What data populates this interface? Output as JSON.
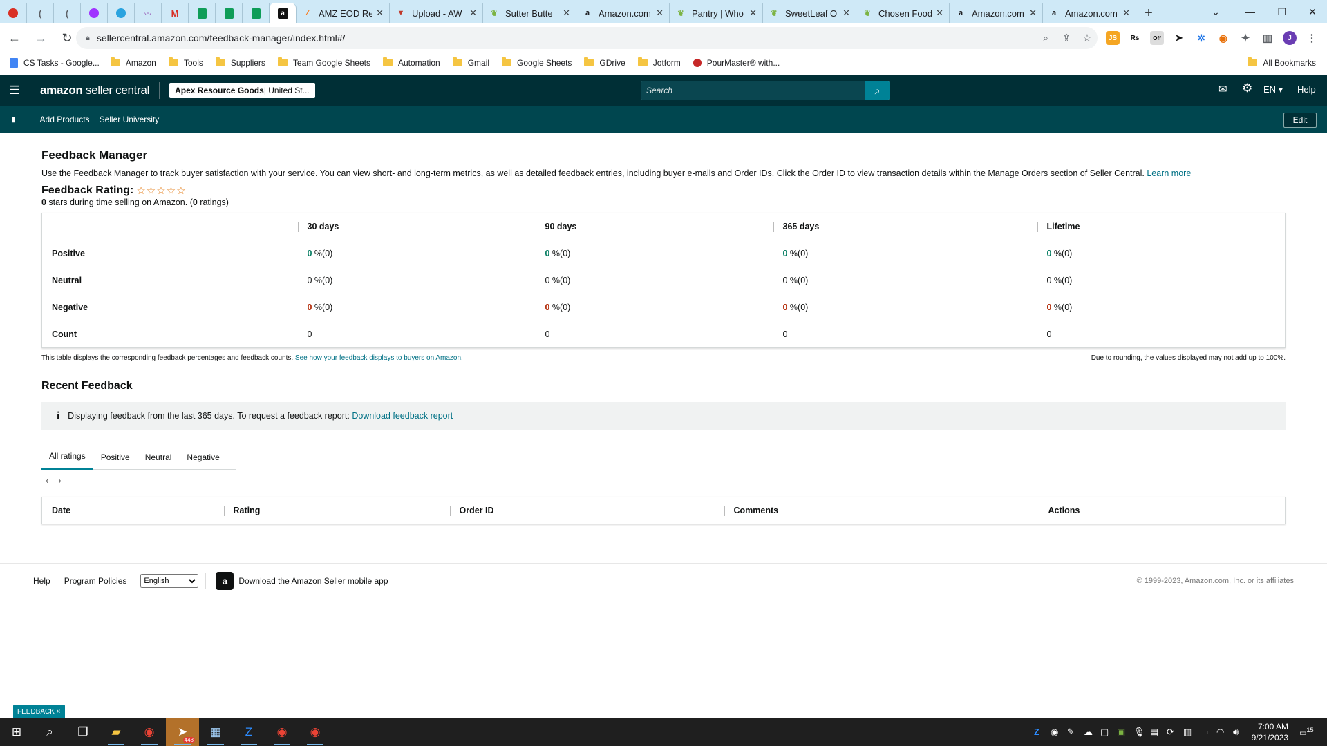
{
  "browser": {
    "tabs": [
      {
        "label": "AMZ EOD Re"
      },
      {
        "label": "Upload - AW"
      },
      {
        "label": "Sutter Butte"
      },
      {
        "label": "Amazon.com"
      },
      {
        "label": "Pantry | Who"
      },
      {
        "label": "SweetLeaf Or"
      },
      {
        "label": "Chosen Food"
      },
      {
        "label": "Amazon.com"
      },
      {
        "label": "Amazon.com"
      }
    ],
    "url": "sellercentral.amazon.com/feedback-manager/index.html#/",
    "ext_off_badge": "Off",
    "profile_initial": "J",
    "bookmarks": [
      "CS Tasks - Google...",
      "Amazon",
      "Tools",
      "Suppliers",
      "Team Google Sheets",
      "Automation",
      "Gmail",
      "Google Sheets",
      "GDrive",
      "Jotform",
      "PourMaster® with..."
    ],
    "all_bookmarks": "All Bookmarks"
  },
  "header": {
    "logo_bold": "amazon",
    "logo_rest": " seller central",
    "store_bold": "Apex Resource Goods",
    "store_rest": " | United St...",
    "search_placeholder": "Search",
    "lang": "EN ▾",
    "help": "Help"
  },
  "subnav": {
    "add_products": "Add Products",
    "seller_university": "Seller University",
    "edit": "Edit"
  },
  "page": {
    "title": "Feedback Manager",
    "desc": "Use the Feedback Manager to track buyer satisfaction with your service. You can view short- and long-term metrics, as well as detailed feedback entries, including buyer e-mails and Order IDs. Click the Order ID to view transaction details within the Manage Orders section of Seller Central.",
    "learn_more": "Learn more",
    "rating_label": "Feedback Rating:",
    "stars": "☆☆☆☆☆",
    "stars_value": "0",
    "stars_text": " stars during time selling on Amazon. (",
    "ratings_count": "0",
    "ratings_text": " ratings)"
  },
  "metrics": {
    "columns": [
      "30 days",
      "90 days",
      "365 days",
      "Lifetime"
    ],
    "rows": [
      {
        "label": "Positive",
        "cells": [
          "0",
          "0",
          "0",
          "0"
        ],
        "suffix": " %(0)"
      },
      {
        "label": "Neutral",
        "cells": [
          "0",
          "0",
          "0",
          "0"
        ],
        "suffix": " %(0)"
      },
      {
        "label": "Negative",
        "cells": [
          "0",
          "0",
          "0",
          "0"
        ],
        "suffix": " %(0)"
      },
      {
        "label": "Count",
        "cells": [
          "0",
          "0",
          "0",
          "0"
        ]
      }
    ],
    "note_left": "This table displays the corresponding feedback percentages and feedback counts.",
    "note_link": "See how your feedback displays to buyers on Amazon.",
    "note_right": "Due to rounding, the values displayed may not add up to 100%."
  },
  "recent": {
    "title": "Recent Feedback",
    "info": "Displaying feedback from the last 365 days. To request a feedback report:",
    "info_link": "Download feedback report",
    "tabs": [
      "All ratings",
      "Positive",
      "Neutral",
      "Negative"
    ],
    "columns": [
      "Date",
      "Rating",
      "Order ID",
      "Comments",
      "Actions"
    ]
  },
  "footer": {
    "help": "Help",
    "policies": "Program Policies",
    "language": "English",
    "app": "Download the Amazon Seller mobile app",
    "copyright": "© 1999-2023, Amazon.com, Inc. or its affiliates",
    "feedback_btn": "FEEDBACK ×"
  },
  "taskbar": {
    "badge": "448",
    "time": "7:00 AM",
    "date": "9/21/2023",
    "notif": "15"
  },
  "colors": {
    "header_bg": "#002f36",
    "subnav_bg": "#00464f",
    "accent": "#008296",
    "positive": "#067d62",
    "negative": "#b12704"
  }
}
